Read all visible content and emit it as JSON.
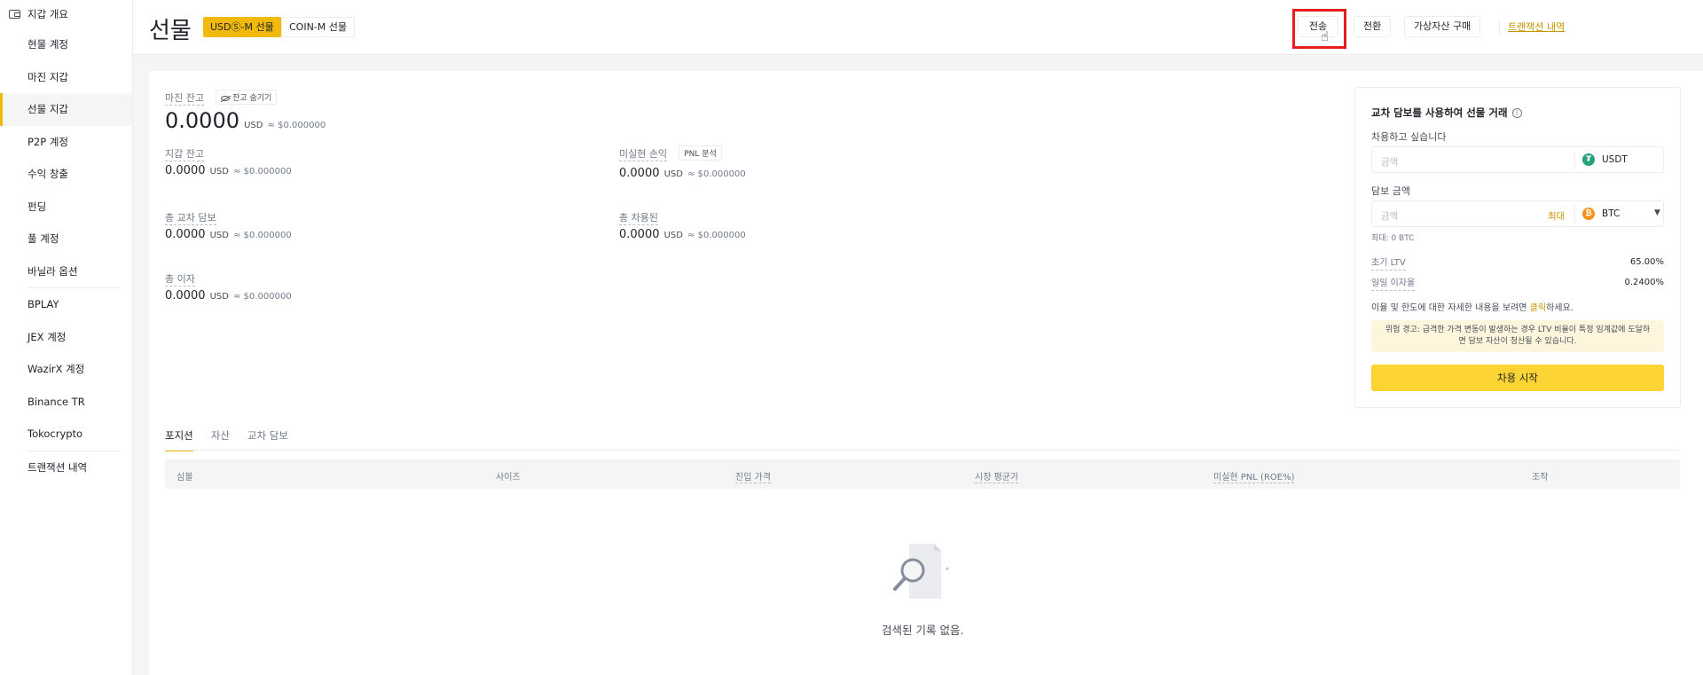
{
  "sidebar": {
    "top": "지갑 개요",
    "items": [
      {
        "label": "현물 계정"
      },
      {
        "label": "마진 지갑"
      },
      {
        "label": "선물 지갑"
      },
      {
        "label": "P2P 계정"
      },
      {
        "label": "수익 창출"
      },
      {
        "label": "펀딩"
      },
      {
        "label": "풀 계정"
      },
      {
        "label": "바닐라 옵션"
      },
      {
        "label": "BPLAY"
      },
      {
        "label": "JEX 계정"
      },
      {
        "label": "WazirX 계정"
      },
      {
        "label": "Binance TR"
      },
      {
        "label": "Tokocrypto"
      },
      {
        "label": "트랜잭션 내역"
      }
    ],
    "active_index": 2
  },
  "header": {
    "title": "선물",
    "tab_usdm": "USDⓈ-M 선물",
    "tab_coinm": "COIN-M 선물",
    "transfer": "전송",
    "convert": "전환",
    "buy_crypto": "가상자산 구매",
    "history_link": "트랜잭션 내역"
  },
  "balances": {
    "margin": {
      "label": "마진 잔고",
      "hide": "잔고 숨기기",
      "value": "0.0000",
      "unit": "USD",
      "approx": "≈ $0.000000"
    },
    "wallet": {
      "label": "지갑 잔고",
      "value": "0.0000",
      "unit": "USD",
      "approx": "≈ $0.000000"
    },
    "unrealized": {
      "label": "미실현 손익",
      "chip": "PNL 분석",
      "value": "0.0000",
      "unit": "USD",
      "approx": "≈ $0.000000"
    },
    "cross_collateral": {
      "label": "총 교차 담보",
      "value": "0.0000",
      "unit": "USD",
      "approx": "≈ $0.000000"
    },
    "borrowed": {
      "label": "총 차용된",
      "value": "0.0000",
      "unit": "USD",
      "approx": "≈ $0.000000"
    },
    "interest": {
      "label": "총 이자",
      "value": "0.0000",
      "unit": "USD",
      "approx": "≈ $0.000000"
    }
  },
  "tabs": [
    "포지션",
    "자산",
    "교차 담보"
  ],
  "table": {
    "headers": [
      "심볼",
      "사이즈",
      "진입 가격",
      "시장 평균가",
      "미실현 PNL (ROE%)",
      "조작"
    ],
    "empty": "검색된 기록 없음."
  },
  "panel": {
    "title": "교차 담보를 사용하여 선물 거래",
    "borrow_label": "차용하고 싶습니다",
    "borrow_placeholder": "금액",
    "borrow_coin": "USDT",
    "collateral_label": "담보 금액",
    "collateral_placeholder": "금액",
    "max": "최대",
    "collateral_coin": "BTC",
    "max_note": "최대: 0 BTC",
    "ltv_label": "초기 LTV",
    "ltv_value": "65.00%",
    "rate_label": "일일 이자율",
    "rate_value": "0.2400%",
    "info_prefix": "이율 및 한도에 대한 자세한 내용을 보려면 ",
    "info_link": "클릭",
    "info_suffix": "하세요.",
    "warning": "위험 경고: 급격한 가격 변동이 발생하는 경우 LTV 비율이 특정 임계값에 도달하면 담보 자산이 청산될 수 있습니다.",
    "start_button": "차용 시작"
  },
  "colors": {
    "accent": "#f0b90b",
    "highlight": "#e61e1e",
    "tether": "#26a17b",
    "bitcoin": "#f7931a"
  }
}
